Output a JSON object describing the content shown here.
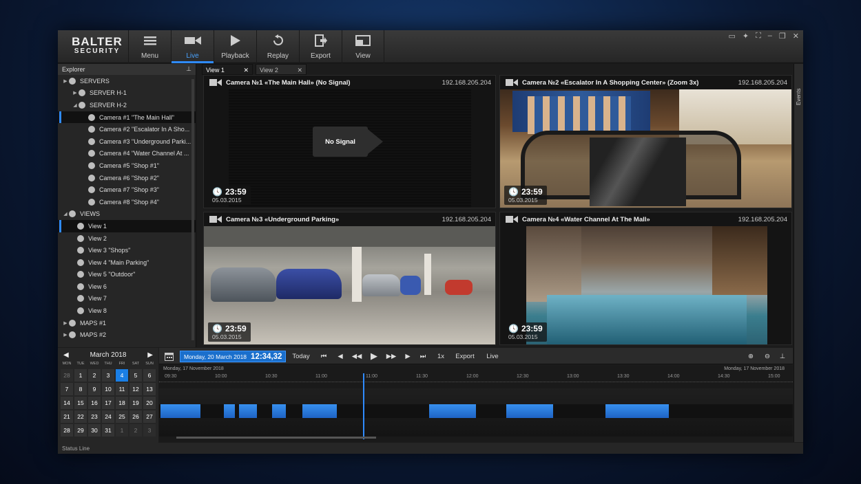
{
  "app": {
    "logo_line1": "BALTER",
    "logo_line2": "SECURITY",
    "accent": "#2f8bff"
  },
  "toolbar": [
    {
      "label": "Menu",
      "icon": "menu-icon"
    },
    {
      "label": "Live",
      "icon": "video-camera-icon",
      "active": true
    },
    {
      "label": "Playback",
      "icon": "play-icon"
    },
    {
      "label": "Replay",
      "icon": "replay-icon"
    },
    {
      "label": "Export",
      "icon": "export-icon"
    },
    {
      "label": "View",
      "icon": "view-layout-icon"
    }
  ],
  "explorer": {
    "title": "Explorer",
    "servers_label": "SERVERS",
    "server1": "SERVER H-1",
    "server2": "SERVER H-2",
    "cameras": [
      "Camera #1 \"The Main Hall\"",
      "Camera #2 \"Escalator In A Sho...",
      "Camera #3 \"Underground Parki...",
      "Camera #4 \"Water Channel At ...",
      "Camera #5 \"Shop #1\"",
      "Camera #6 \"Shop #2\"",
      "Camera #7 \"Shop #3\"",
      "Camera #8 \"Shop #4\""
    ],
    "views_label": "VIEWS",
    "views": [
      "View 1",
      "View 2",
      "View 3 \"Shops\"",
      "View 4 \"Main Parking\"",
      "View 5 \"Outdoor\"",
      "View 6",
      "View 7",
      "View 8"
    ],
    "maps": [
      "MAPS #1",
      "MAPS #2"
    ]
  },
  "tabs": [
    "View 1",
    "View 2"
  ],
  "events_label": "Events",
  "cameras": [
    {
      "title": "Camera №1 «The Main Hall» (No Signal)",
      "ip": "192.168.205.204",
      "time": "23:59",
      "date": "05.03.2015",
      "no_signal": "No Signal"
    },
    {
      "title": "Camera №2 «Escalator In A Shopping Center» (Zoom 3x)",
      "ip": "192.168.205.204",
      "time": "23:59",
      "date": "05.03.2015"
    },
    {
      "title": "Camera №3 «Underground Parking»",
      "ip": "192.168.205.204",
      "time": "23:59",
      "date": "05.03.2015"
    },
    {
      "title": "Camera №4 «Water Channel At The Mall»",
      "ip": "192.168.205.204",
      "time": "23:59",
      "date": "05.03.2015"
    }
  ],
  "calendar": {
    "month": "March 2018",
    "dows": [
      "MON",
      "TUE",
      "WED",
      "THU",
      "FRI",
      "SAT",
      "SUN"
    ],
    "days": [
      "28",
      "1",
      "2",
      "3",
      "4",
      "5",
      "6",
      "7",
      "8",
      "9",
      "10",
      "11",
      "12",
      "13",
      "14",
      "15",
      "16",
      "17",
      "18",
      "19",
      "20",
      "21",
      "22",
      "23",
      "24",
      "25",
      "26",
      "27",
      "28",
      "29",
      "30",
      "31",
      "1",
      "2",
      "3"
    ],
    "selected_index": 4
  },
  "controls": {
    "date": "Monday, 20 March 2018",
    "time": "12:34,32",
    "today": "Today",
    "speed": "1x",
    "export": "Export",
    "live": "Live"
  },
  "timeline": {
    "date_left": "Monday, 17 November 2018",
    "date_right": "Monday, 17 November 2018",
    "ticks": [
      "09:30",
      "10:00",
      "10:30",
      "11:00",
      "11:00",
      "11:30",
      "12:00",
      "12:30",
      "13:00",
      "13:30",
      "14:00",
      "14:30",
      "15:00"
    ]
  },
  "status_line": "Status Line"
}
